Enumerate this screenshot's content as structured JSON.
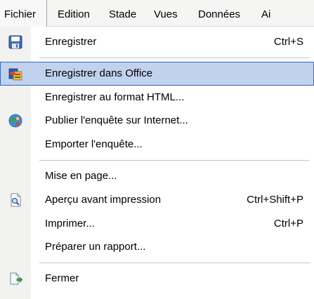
{
  "menubar": {
    "items": [
      "Fichier",
      "Edition",
      "Stade",
      "Vues",
      "Données",
      "Ai"
    ]
  },
  "menu": {
    "items": [
      {
        "label": "Enregistrer",
        "shortcut": "Ctrl+S",
        "icon": "save-icon"
      },
      {
        "label": "Enregistrer dans Office",
        "icon": "office-export-icon"
      },
      {
        "label": "Enregistrer au format HTML..."
      },
      {
        "label": "Publier l'enquête sur Internet...",
        "icon": "globe-person-icon"
      },
      {
        "label": "Emporter l'enquête..."
      },
      {
        "label": "Mise en page..."
      },
      {
        "label": "Aperçu avant impression",
        "shortcut": "Ctrl+Shift+P",
        "icon": "print-preview-icon"
      },
      {
        "label": "Imprimer...",
        "shortcut": "Ctrl+P"
      },
      {
        "label": "Préparer un rapport..."
      },
      {
        "label": "Fermer",
        "icon": "close-document-icon"
      }
    ]
  },
  "colors": {
    "highlight_fill": "#c1d2ee",
    "highlight_border": "#316ac5",
    "gutter": "#f2f2f0",
    "menubar": "#f5f5f4"
  }
}
